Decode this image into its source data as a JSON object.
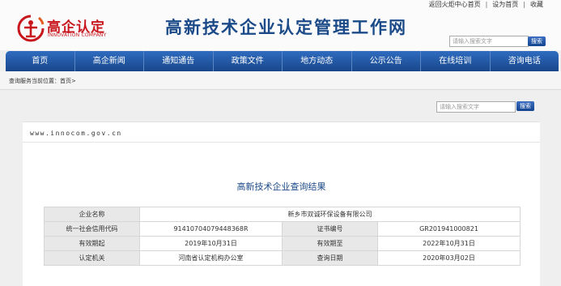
{
  "top_links": [
    "返回火炬中心首页",
    "设为首页",
    "收藏"
  ],
  "logo": {
    "name": "高企认定",
    "english": "INNOVATION COMPANY"
  },
  "site_title": "高新技术企业认定管理工作网",
  "search": {
    "placeholder": "请输入搜索文字",
    "button": "搜索"
  },
  "nav": [
    "首页",
    "高企新闻",
    "通知通告",
    "政策文件",
    "地方动态",
    "公示公告",
    "在线培训",
    "咨询电话"
  ],
  "breadcrumb": {
    "prefix": "查询服务当前位置：",
    "current": "首页>"
  },
  "search2": {
    "placeholder": "请输入搜索文字",
    "button": "搜索"
  },
  "domain": "www.innocom.gov.cn",
  "result_title": "高新技术企业查询结果",
  "company": {
    "label": "企业名称",
    "value": "新乡市双诚环保设备有限公司"
  },
  "rows": [
    {
      "l1": "统一社会信用代码",
      "v1": "91410704079448368R",
      "l2": "证书编号",
      "v2": "GR201941000821"
    },
    {
      "l1": "有效期起",
      "v1": "2019年10月31日",
      "l2": "有效期至",
      "v2": "2022年10月31日"
    },
    {
      "l1": "认定机关",
      "v1": "河南省认定机构办公室",
      "l2": "查询日期",
      "v2": "2020年03月02日"
    }
  ],
  "colors": {
    "brand_red": "#c8161d",
    "nav_blue": "#1f56a3",
    "title_blue": "#1b4a88"
  }
}
